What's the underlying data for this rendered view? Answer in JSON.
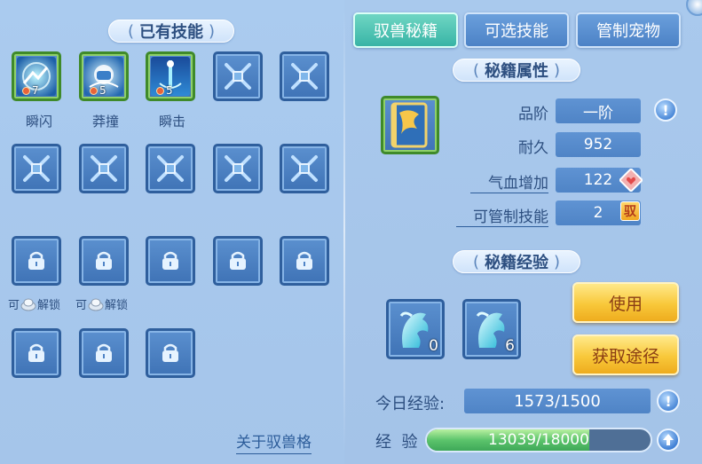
{
  "left": {
    "title": "已有技能",
    "skills": [
      {
        "name": "瞬闪",
        "level": "7"
      },
      {
        "name": "莽撞",
        "level": "5"
      },
      {
        "name": "瞬击",
        "level": "5"
      }
    ],
    "unlock_hint": "可",
    "unlock_hint_suffix": "解锁",
    "about_link": "关于驭兽格"
  },
  "tabs": [
    "驭兽秘籍",
    "可选技能",
    "管制宠物"
  ],
  "active_tab": 0,
  "attributes": {
    "title": "秘籍属性",
    "rows": [
      {
        "label": "品阶",
        "value": "一阶"
      },
      {
        "label": "耐久",
        "value": "952"
      },
      {
        "label": "气血增加",
        "value": "122"
      },
      {
        "label": "可管制技能",
        "value": "2"
      }
    ],
    "yu_badge": "驭"
  },
  "experience": {
    "title": "秘籍经验",
    "items": [
      {
        "count": "0"
      },
      {
        "count": "6"
      }
    ],
    "use_button": "使用",
    "obtain_button": "获取途径",
    "daily_label": "今日经验:",
    "daily_value": "1573/1500",
    "exp_label": "经  验",
    "exp_value": "13039/18000",
    "exp_current": 13039,
    "exp_max": 18000
  },
  "colors": {
    "accent_active_tab": "#38b4a6",
    "panel_bg": "#a9c9ed",
    "text": "#2d4f80",
    "gold_button": "#f8c83a"
  }
}
